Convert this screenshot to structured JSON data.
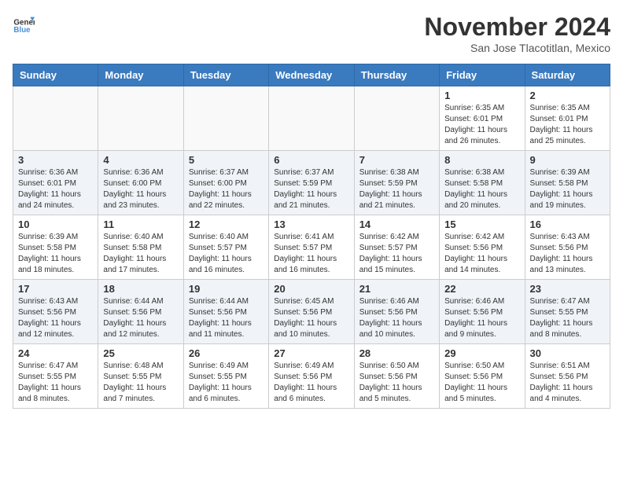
{
  "header": {
    "logo_line1": "General",
    "logo_line2": "Blue",
    "month_title": "November 2024",
    "location": "San Jose Tlacotitlan, Mexico"
  },
  "days_of_week": [
    "Sunday",
    "Monday",
    "Tuesday",
    "Wednesday",
    "Thursday",
    "Friday",
    "Saturday"
  ],
  "weeks": [
    [
      {
        "day": "",
        "info": ""
      },
      {
        "day": "",
        "info": ""
      },
      {
        "day": "",
        "info": ""
      },
      {
        "day": "",
        "info": ""
      },
      {
        "day": "",
        "info": ""
      },
      {
        "day": "1",
        "info": "Sunrise: 6:35 AM\nSunset: 6:01 PM\nDaylight: 11 hours and 26 minutes."
      },
      {
        "day": "2",
        "info": "Sunrise: 6:35 AM\nSunset: 6:01 PM\nDaylight: 11 hours and 25 minutes."
      }
    ],
    [
      {
        "day": "3",
        "info": "Sunrise: 6:36 AM\nSunset: 6:01 PM\nDaylight: 11 hours and 24 minutes."
      },
      {
        "day": "4",
        "info": "Sunrise: 6:36 AM\nSunset: 6:00 PM\nDaylight: 11 hours and 23 minutes."
      },
      {
        "day": "5",
        "info": "Sunrise: 6:37 AM\nSunset: 6:00 PM\nDaylight: 11 hours and 22 minutes."
      },
      {
        "day": "6",
        "info": "Sunrise: 6:37 AM\nSunset: 5:59 PM\nDaylight: 11 hours and 21 minutes."
      },
      {
        "day": "7",
        "info": "Sunrise: 6:38 AM\nSunset: 5:59 PM\nDaylight: 11 hours and 21 minutes."
      },
      {
        "day": "8",
        "info": "Sunrise: 6:38 AM\nSunset: 5:58 PM\nDaylight: 11 hours and 20 minutes."
      },
      {
        "day": "9",
        "info": "Sunrise: 6:39 AM\nSunset: 5:58 PM\nDaylight: 11 hours and 19 minutes."
      }
    ],
    [
      {
        "day": "10",
        "info": "Sunrise: 6:39 AM\nSunset: 5:58 PM\nDaylight: 11 hours and 18 minutes."
      },
      {
        "day": "11",
        "info": "Sunrise: 6:40 AM\nSunset: 5:58 PM\nDaylight: 11 hours and 17 minutes."
      },
      {
        "day": "12",
        "info": "Sunrise: 6:40 AM\nSunset: 5:57 PM\nDaylight: 11 hours and 16 minutes."
      },
      {
        "day": "13",
        "info": "Sunrise: 6:41 AM\nSunset: 5:57 PM\nDaylight: 11 hours and 16 minutes."
      },
      {
        "day": "14",
        "info": "Sunrise: 6:42 AM\nSunset: 5:57 PM\nDaylight: 11 hours and 15 minutes."
      },
      {
        "day": "15",
        "info": "Sunrise: 6:42 AM\nSunset: 5:56 PM\nDaylight: 11 hours and 14 minutes."
      },
      {
        "day": "16",
        "info": "Sunrise: 6:43 AM\nSunset: 5:56 PM\nDaylight: 11 hours and 13 minutes."
      }
    ],
    [
      {
        "day": "17",
        "info": "Sunrise: 6:43 AM\nSunset: 5:56 PM\nDaylight: 11 hours and 12 minutes."
      },
      {
        "day": "18",
        "info": "Sunrise: 6:44 AM\nSunset: 5:56 PM\nDaylight: 11 hours and 12 minutes."
      },
      {
        "day": "19",
        "info": "Sunrise: 6:44 AM\nSunset: 5:56 PM\nDaylight: 11 hours and 11 minutes."
      },
      {
        "day": "20",
        "info": "Sunrise: 6:45 AM\nSunset: 5:56 PM\nDaylight: 11 hours and 10 minutes."
      },
      {
        "day": "21",
        "info": "Sunrise: 6:46 AM\nSunset: 5:56 PM\nDaylight: 11 hours and 10 minutes."
      },
      {
        "day": "22",
        "info": "Sunrise: 6:46 AM\nSunset: 5:56 PM\nDaylight: 11 hours and 9 minutes."
      },
      {
        "day": "23",
        "info": "Sunrise: 6:47 AM\nSunset: 5:55 PM\nDaylight: 11 hours and 8 minutes."
      }
    ],
    [
      {
        "day": "24",
        "info": "Sunrise: 6:47 AM\nSunset: 5:55 PM\nDaylight: 11 hours and 8 minutes."
      },
      {
        "day": "25",
        "info": "Sunrise: 6:48 AM\nSunset: 5:55 PM\nDaylight: 11 hours and 7 minutes."
      },
      {
        "day": "26",
        "info": "Sunrise: 6:49 AM\nSunset: 5:55 PM\nDaylight: 11 hours and 6 minutes."
      },
      {
        "day": "27",
        "info": "Sunrise: 6:49 AM\nSunset: 5:56 PM\nDaylight: 11 hours and 6 minutes."
      },
      {
        "day": "28",
        "info": "Sunrise: 6:50 AM\nSunset: 5:56 PM\nDaylight: 11 hours and 5 minutes."
      },
      {
        "day": "29",
        "info": "Sunrise: 6:50 AM\nSunset: 5:56 PM\nDaylight: 11 hours and 5 minutes."
      },
      {
        "day": "30",
        "info": "Sunrise: 6:51 AM\nSunset: 5:56 PM\nDaylight: 11 hours and 4 minutes."
      }
    ]
  ]
}
